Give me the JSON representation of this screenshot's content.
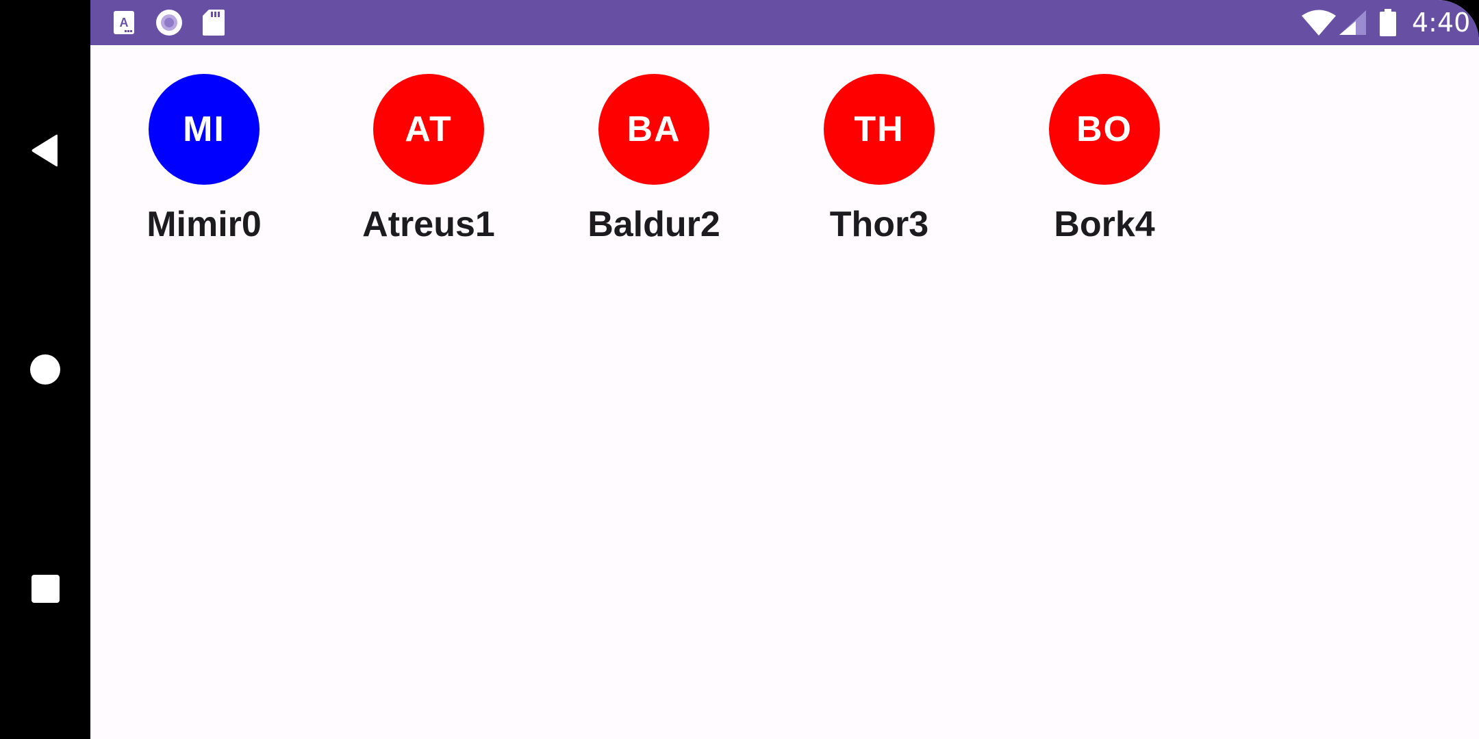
{
  "status_bar": {
    "time": "4:40",
    "background_color": "#6750a4",
    "left_icons": [
      "font-notification-icon",
      "circle-notification-icon",
      "sd-card-icon"
    ],
    "right_icons": [
      "wifi-icon",
      "cell-signal-icon",
      "battery-icon"
    ]
  },
  "navigation_bar": {
    "buttons": [
      "back-icon",
      "home-icon",
      "recents-icon"
    ]
  },
  "users": [
    {
      "initials": "MI",
      "name": "Mimir0",
      "color": "#0000ff"
    },
    {
      "initials": "AT",
      "name": "Atreus1",
      "color": "#ff0000"
    },
    {
      "initials": "BA",
      "name": "Baldur2",
      "color": "#ff0000"
    },
    {
      "initials": "TH",
      "name": "Thor3",
      "color": "#ff0000"
    },
    {
      "initials": "BO",
      "name": "Bork4",
      "color": "#ff0000"
    }
  ],
  "colors": {
    "screen_background": "#fffbfe",
    "name_text": "#1c1b1f"
  }
}
